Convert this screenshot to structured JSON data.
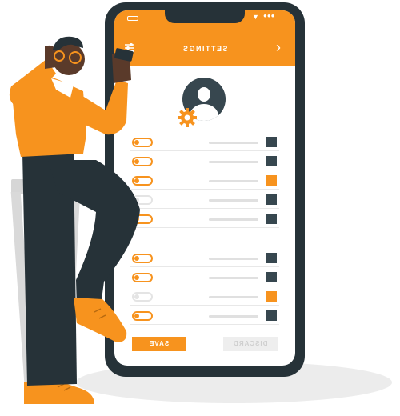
{
  "header": {
    "title": "SETTINGS",
    "back_icon": "chevron-left-icon",
    "filter_icon": "sliders-icon"
  },
  "status_bar": {
    "battery_icon": "battery-icon",
    "wifi_icon": "wifi-icon",
    "signal_icon": "signal-dots-icon"
  },
  "profile": {
    "avatar_icon": "user-avatar-icon",
    "edit_icon": "gear-icon"
  },
  "settings_rows": [
    {
      "toggle_on": true,
      "checked": false
    },
    {
      "toggle_on": true,
      "checked": false
    },
    {
      "toggle_on": true,
      "checked": true
    },
    {
      "toggle_on": false,
      "checked": false
    },
    {
      "toggle_on": true,
      "checked": false
    },
    {
      "toggle_on": true,
      "checked": false
    },
    {
      "toggle_on": true,
      "checked": false
    },
    {
      "toggle_on": false,
      "checked": true
    },
    {
      "toggle_on": true,
      "checked": false
    }
  ],
  "buttons": {
    "save_label": "SAVE",
    "discard_label": "DISCARD"
  },
  "colors": {
    "accent": "#f7931e",
    "dark": "#263238",
    "slate": "#37474f"
  }
}
